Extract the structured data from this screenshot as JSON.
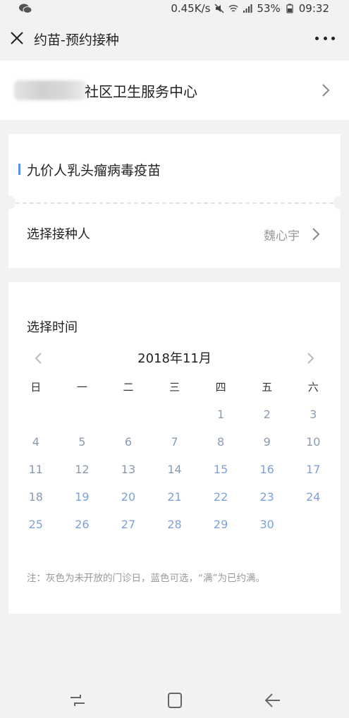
{
  "status_bar": {
    "app_icon": "wechat-icon",
    "speed": "0.45K/s",
    "battery": "53%",
    "time": "09:32"
  },
  "nav": {
    "close_icon": "close-icon",
    "title": "约苗-预约接种",
    "more_icon": "more-icon"
  },
  "hospital": {
    "name": "社区卫生服务中心"
  },
  "vaccine": {
    "name": "九价人乳头瘤病毒疫苗",
    "person_label": "选择接种人",
    "person_value": "魏心宇"
  },
  "calendar": {
    "title": "选择时间",
    "month": "2018年11月",
    "weekdays": [
      "日",
      "一",
      "二",
      "三",
      "四",
      "五",
      "六"
    ],
    "weeks": [
      [
        {
          "d": ""
        },
        {
          "d": ""
        },
        {
          "d": ""
        },
        {
          "d": ""
        },
        {
          "d": "1",
          "s": "gray"
        },
        {
          "d": "2",
          "s": "gray"
        },
        {
          "d": "3",
          "s": "gray"
        }
      ],
      [
        {
          "d": "4",
          "s": "gray"
        },
        {
          "d": "5",
          "s": "gray"
        },
        {
          "d": "6",
          "s": "gray"
        },
        {
          "d": "7",
          "s": "gray"
        },
        {
          "d": "8",
          "s": "gray"
        },
        {
          "d": "9",
          "s": "gray"
        },
        {
          "d": "10",
          "s": "gray"
        }
      ],
      [
        {
          "d": "11",
          "s": "gray"
        },
        {
          "d": "12",
          "s": "gray"
        },
        {
          "d": "13",
          "s": "gray"
        },
        {
          "d": "14",
          "s": "gray"
        },
        {
          "d": "15",
          "s": "blue"
        },
        {
          "d": "16",
          "s": "blue"
        },
        {
          "d": "17",
          "s": "blue"
        }
      ],
      [
        {
          "d": "18",
          "s": "gray"
        },
        {
          "d": "19",
          "s": "blue"
        },
        {
          "d": "20",
          "s": "blue"
        },
        {
          "d": "21",
          "s": "blue"
        },
        {
          "d": "22",
          "s": "blue"
        },
        {
          "d": "23",
          "s": "blue"
        },
        {
          "d": "24",
          "s": "blue"
        }
      ],
      [
        {
          "d": "25",
          "s": "blue"
        },
        {
          "d": "26",
          "s": "blue"
        },
        {
          "d": "27",
          "s": "blue"
        },
        {
          "d": "28",
          "s": "blue"
        },
        {
          "d": "29",
          "s": "blue"
        },
        {
          "d": "30",
          "s": "blue"
        },
        {
          "d": ""
        }
      ]
    ],
    "note": "注：灰色为未开放的门诊日，蓝色可选，“满”为已约满。"
  },
  "colors": {
    "accent": "#5b8fe8",
    "available_day": "#7ea2d8",
    "unavailable_day": "#8a9bb0",
    "background": "#f2f2f5"
  }
}
